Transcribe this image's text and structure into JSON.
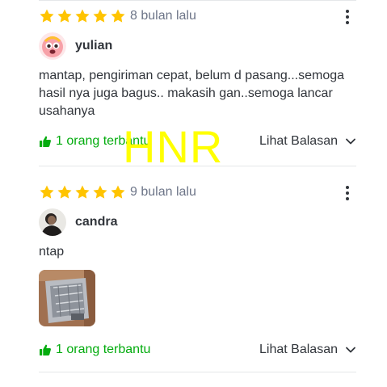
{
  "colors": {
    "star": "#ffc400",
    "helpful": "#03ac0e",
    "text": "#31353b",
    "muted": "#6d7588",
    "watermark": "#ffff00",
    "divider": "#e5e7e9"
  },
  "reviews": [
    {
      "stars": 5,
      "time": "8 bulan lalu",
      "username": "yulian",
      "avatar_icon": "smiling-face-avatar-icon",
      "text": "mantap, pengiriman cepat, belum d pasang...semoga hasil nya juga bagus.. makasih gan..semoga lancar usahanya",
      "helpful_label": "1 orang terbantu",
      "replies_label": "Lihat Balasan"
    },
    {
      "stars": 5,
      "time": "9 bulan lalu",
      "username": "candra",
      "avatar_icon": "person-photo-avatar",
      "text": "ntap",
      "photo_icon": "product-package-photo",
      "helpful_label": "1 orang terbantu",
      "replies_label": "Lihat Balasan"
    }
  ],
  "watermark": "HNR"
}
